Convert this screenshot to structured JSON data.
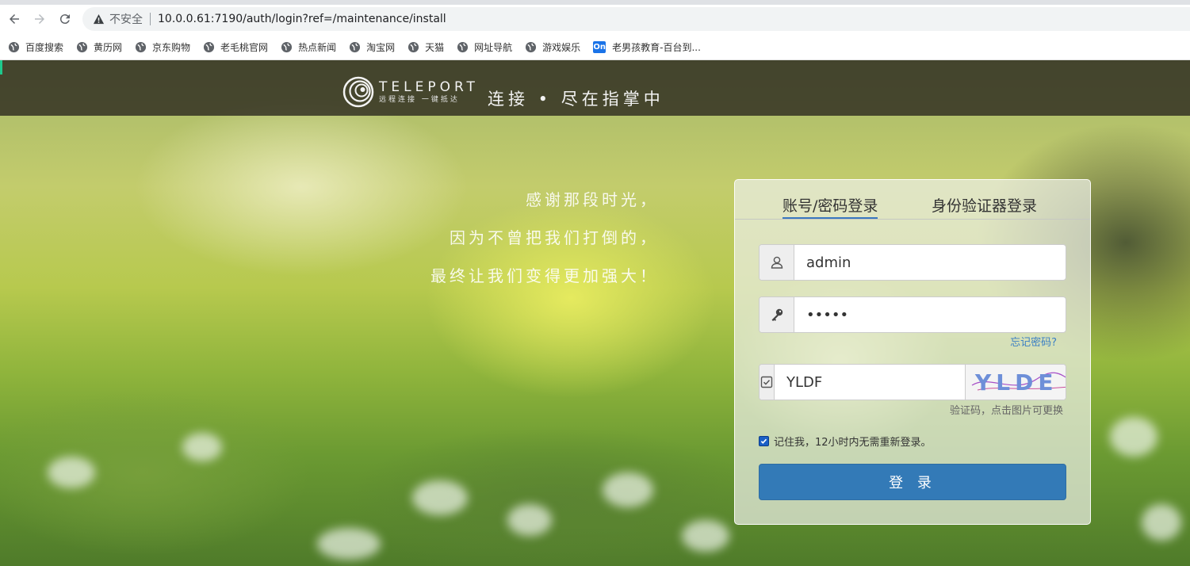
{
  "browser": {
    "insecure_label": "不安全",
    "url": "10.0.0.61:7190/auth/login?ref=/maintenance/install",
    "bookmarks": [
      {
        "label": "百度搜索",
        "icon": "globe-icon"
      },
      {
        "label": "黄历网",
        "icon": "globe-icon"
      },
      {
        "label": "京东购物",
        "icon": "globe-icon"
      },
      {
        "label": "老毛桃官网",
        "icon": "globe-icon"
      },
      {
        "label": "热点新闻",
        "icon": "globe-icon"
      },
      {
        "label": "淘宝网",
        "icon": "globe-icon"
      },
      {
        "label": "天猫",
        "icon": "globe-icon"
      },
      {
        "label": "网址导航",
        "icon": "globe-icon"
      },
      {
        "label": "游戏娱乐",
        "icon": "globe-icon"
      },
      {
        "label": "老男孩教育-百台到...",
        "icon": "on-badge-icon",
        "badge": "On"
      }
    ]
  },
  "banner": {
    "logo_name": "TELEPORT",
    "logo_sub": "远程连接 一键抵达",
    "slogan": "连接 • 尽在指掌中"
  },
  "poem": {
    "line1": "感谢那段时光，",
    "line2": "因为不曾把我们打倒的，",
    "line3": "最终让我们变得更加强大！"
  },
  "login": {
    "tab_password": "账号/密码登录",
    "tab_authenticator": "身份验证器登录",
    "username_value": "admin",
    "password_value": "•••••",
    "forgot_password": "忘记密码?",
    "captcha_value": "YLDF",
    "captcha_image_text": "YLDE",
    "captcha_hint": "验证码，点击图片可更换",
    "remember_label": "记住我，12小时内无需重新登录。",
    "remember_checked": true,
    "submit_label": "登 录"
  },
  "colors": {
    "primary": "#337ab7",
    "link": "#3b7fc4",
    "accent": "#1ec98c"
  }
}
